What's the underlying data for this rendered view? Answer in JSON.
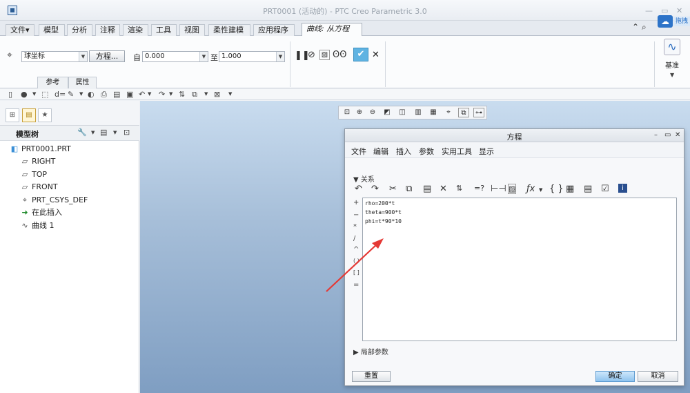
{
  "window": {
    "title": "PRT0001 (活动的) - PTC Creo Parametric 3.0",
    "ext_widget_label": "拖拽"
  },
  "ribbon": {
    "tabs": [
      "文件▾",
      "模型",
      "分析",
      "注释",
      "渲染",
      "工具",
      "视图",
      "柔性建模",
      "应用程序"
    ],
    "active_tab": "曲线: 从方程",
    "csys_type": "球坐标",
    "equation_button": "方程...",
    "from_label": "自",
    "from_value": "0.000",
    "to_label": "至",
    "to_value": "1.000",
    "sub_tabs": [
      "参考",
      "属性"
    ],
    "datum_label": "基准"
  },
  "model_tree": {
    "title": "模型树",
    "items": [
      {
        "icon": "part-icon",
        "label": "PRT0001.PRT"
      },
      {
        "icon": "plane-icon",
        "label": "RIGHT"
      },
      {
        "icon": "plane-icon",
        "label": "TOP"
      },
      {
        "icon": "plane-icon",
        "label": "FRONT"
      },
      {
        "icon": "csys-icon",
        "label": "PRT_CSYS_DEF"
      },
      {
        "icon": "insert-arrow-icon",
        "label": "在此插入"
      },
      {
        "icon": "curve-icon",
        "label": "曲线 1"
      }
    ]
  },
  "dialog": {
    "title": "方程",
    "menu": [
      "文件",
      "编辑",
      "插入",
      "参数",
      "实用工具",
      "显示"
    ],
    "relations_label": "关系",
    "operators": [
      "+",
      "−",
      "*",
      "/",
      "^",
      "( )",
      "[ ]",
      "="
    ],
    "equations": [
      "rho=200*t",
      "theta=900*t",
      "phi=t*90*10"
    ],
    "local_params_label": "局部参数",
    "reset_button": "重置",
    "ok_button": "确定",
    "cancel_button": "取消"
  },
  "colors": {
    "annotation_arrow": "#e53935",
    "ok_accent": "#5fb3e2"
  }
}
